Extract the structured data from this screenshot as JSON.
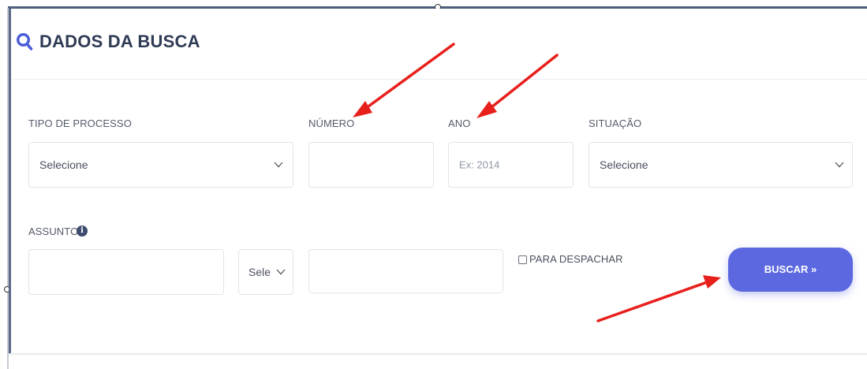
{
  "header": {
    "title": "DADOS DA BUSCA",
    "icon": "search-icon",
    "accent": "#4a5dd8"
  },
  "fields": {
    "tipo_processo": {
      "label": "TIPO DE PROCESSO",
      "value": "Selecione"
    },
    "numero": {
      "label": "NÚMERO",
      "value": ""
    },
    "ano": {
      "label": "ANO",
      "placeholder": "Ex: 2014"
    },
    "situacao": {
      "label": "SITUAÇÃO",
      "value": "Selecione"
    },
    "assunto": {
      "label": "ASSUNTO",
      "info_icon": "info-icon",
      "value": "",
      "select_value": "Sele",
      "text_value": ""
    },
    "para_despachar": {
      "label": "PARA DESPACHAR",
      "checked": false
    }
  },
  "actions": {
    "buscar_label": "BUSCAR »",
    "button_color": "#5b68df"
  },
  "annotations": {
    "arrow_color": "#e8201c",
    "count": 3
  }
}
